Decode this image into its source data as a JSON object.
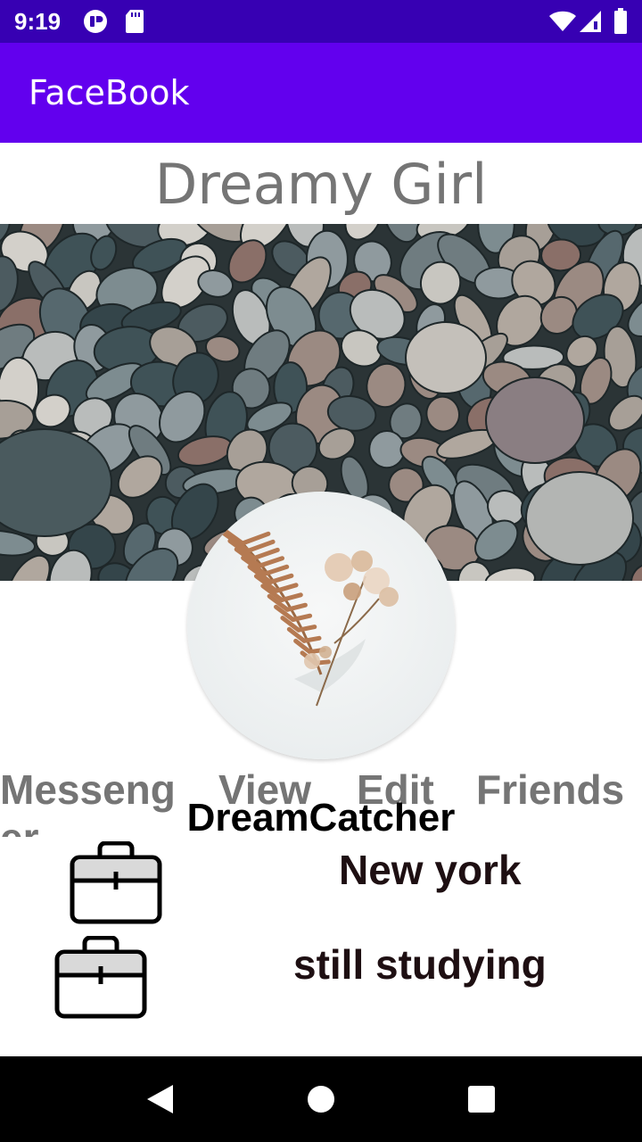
{
  "status_bar": {
    "time": "9:19",
    "left_icons": [
      "app-notification-icon",
      "sd-card-icon"
    ],
    "right_icons": [
      "wifi-icon",
      "signal-icon",
      "battery-icon"
    ],
    "background": "#3700b3"
  },
  "app_bar": {
    "title": "FaceBook",
    "background": "#6200ee"
  },
  "profile": {
    "name": "Dreamy Girl",
    "username": "DreamCatcher",
    "cover_image": "pebbles-photo",
    "avatar_image": "dried-fern-flower-photo"
  },
  "actions": [
    {
      "label": "Messenger"
    },
    {
      "label": "View"
    },
    {
      "label": "Edit"
    },
    {
      "label": "Friends"
    }
  ],
  "info": {
    "location": "New york",
    "work": "still studying",
    "icon": "briefcase-icon"
  },
  "nav_bar": {
    "buttons": [
      "back-icon",
      "home-icon",
      "recents-icon"
    ]
  }
}
